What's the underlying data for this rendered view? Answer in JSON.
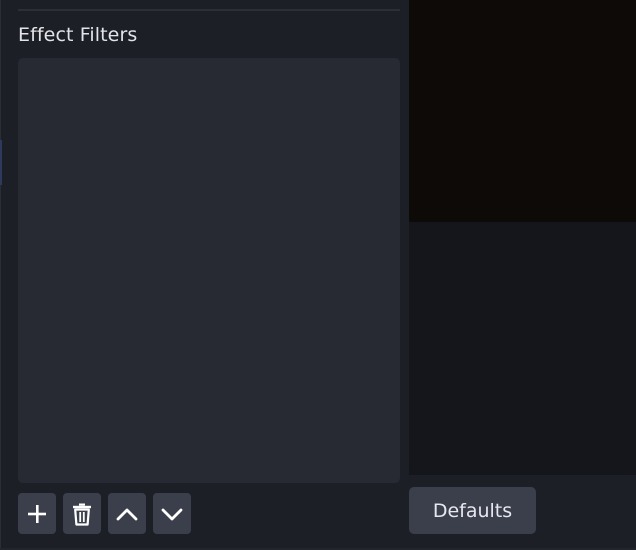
{
  "filters": {
    "title": "Effect Filters",
    "items": []
  },
  "toolbar": {
    "add_icon": "plus-icon",
    "remove_icon": "trash-icon",
    "move_up_icon": "chevron-up-icon",
    "move_down_icon": "chevron-down-icon"
  },
  "preview": {
    "defaults_label": "Defaults"
  },
  "colors": {
    "background": "#1d1f26",
    "list_background": "#272a33",
    "button_background": "#3b3f4b",
    "preview_background": "#15161b",
    "preview_canvas": "#0d0a08",
    "text": "#e2e4ea"
  }
}
